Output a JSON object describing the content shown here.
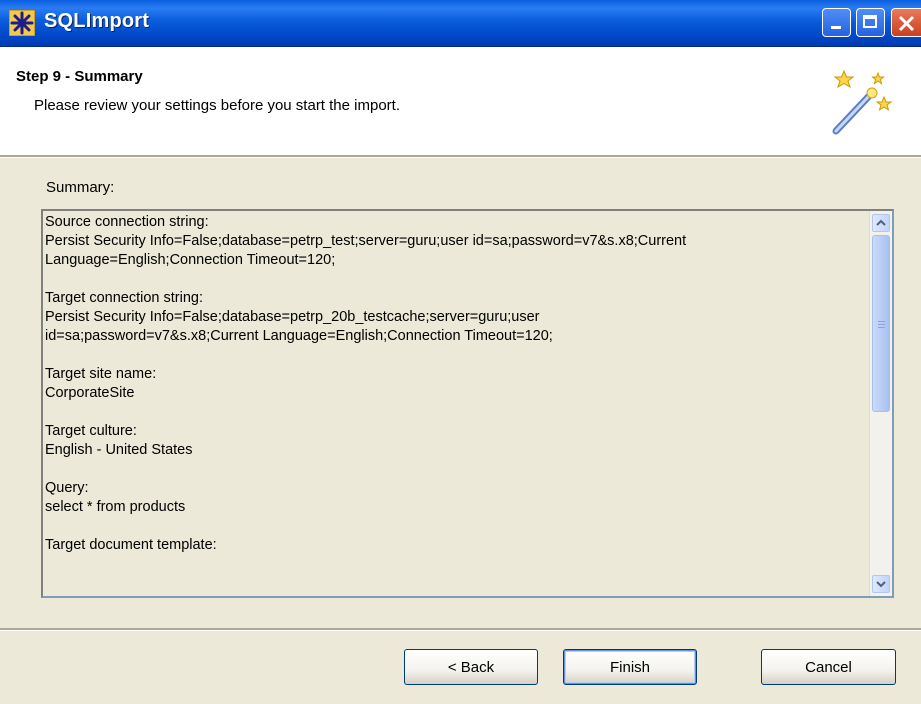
{
  "window": {
    "title": "SQLImport"
  },
  "header": {
    "step_title": "Step 9 - Summary",
    "step_description": "Please review your settings before you start the import."
  },
  "summary": {
    "label": "Summary:",
    "blocks": [
      {
        "lines": [
          "Source connection string:",
          "Persist Security Info=False;database=petrp_test;server=guru;user id=sa;password=v7&s.x8;Current",
          "Language=English;Connection Timeout=120;"
        ]
      },
      {
        "lines": [
          "Target connection string:",
          "Persist Security Info=False;database=petrp_20b_testcache;server=guru;user",
          "id=sa;password=v7&s.x8;Current Language=English;Connection Timeout=120;"
        ]
      },
      {
        "lines": [
          "Target site name:",
          "CorporateSite"
        ]
      },
      {
        "lines": [
          "Target culture:",
          "English - United States"
        ]
      },
      {
        "lines": [
          "Query:",
          "select * from products"
        ]
      },
      {
        "lines": [
          "Target document template:"
        ]
      }
    ],
    "scroll_position": 0
  },
  "buttons": {
    "back": "< Back",
    "finish": "Finish",
    "cancel": "Cancel"
  },
  "colors": {
    "titlebar": "#0a5ddc",
    "face": "#ece9d8",
    "scrollbar_thumb": "#b6cbf5",
    "accent": "#003c74"
  },
  "icons": {
    "app": "asterisk-app-icon",
    "wizard": "magic-wand-icon"
  }
}
